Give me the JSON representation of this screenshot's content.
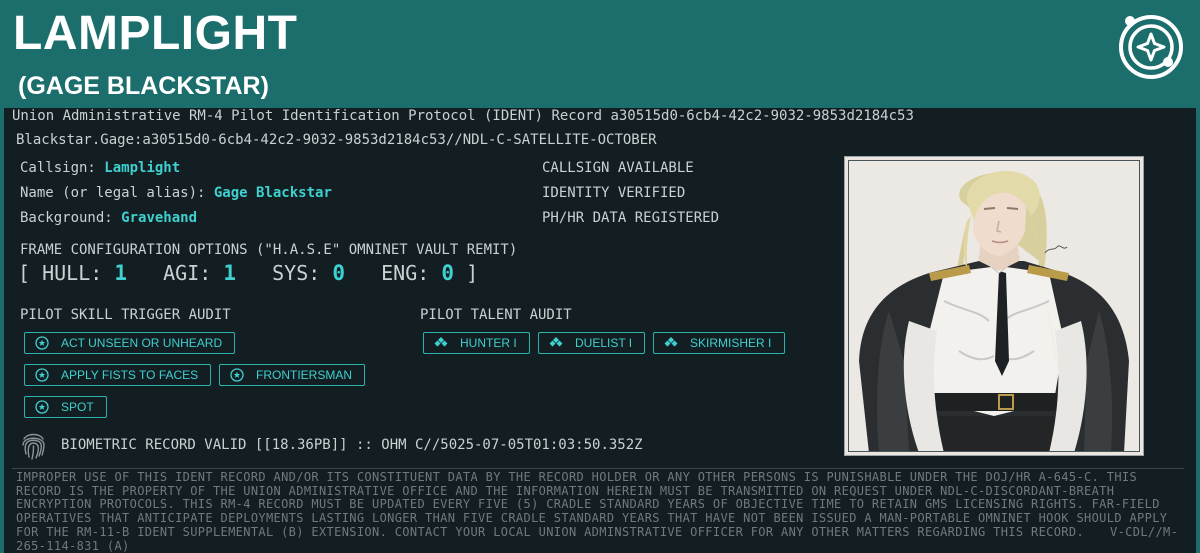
{
  "header": {
    "callsign_title": "LAMPLIGHT",
    "name_subtitle": "(GAGE BLACKSTAR)",
    "logo_icon": "compass-star-icon"
  },
  "record": {
    "ident_line": "Union Administrative RM-4 Pilot Identification Protocol (IDENT) Record a30515d0-6cb4-42c2-9032-9853d2184c53",
    "path_line": "Blackstar.Gage:a30515d0-6cb4-42c2-9032-9853d2184c53//NDL-C-SATELLITE-OCTOBER"
  },
  "fields": {
    "callsign_label": "Callsign:",
    "callsign_value": "Lamplight",
    "name_label": "Name (or legal alias):",
    "name_value": "Gage Blackstar",
    "background_label": "Background:",
    "background_value": "Gravehand"
  },
  "status": {
    "callsign": "CALLSIGN AVAILABLE",
    "identity": "IDENTITY VERIFIED",
    "phhr": "PH/HR DATA REGISTERED"
  },
  "frame": {
    "heading": "FRAME CONFIGURATION OPTIONS (\"H.A.S.E\" OMNINET VAULT REMIT)",
    "open_bracket": "[",
    "hull_label": "HULL:",
    "hull_value": "1",
    "agi_label": "AGI:",
    "agi_value": "1",
    "sys_label": "SYS:",
    "sys_value": "0",
    "eng_label": "ENG:",
    "eng_value": "0",
    "close_bracket": "]"
  },
  "skills": {
    "heading": "PILOT SKILL TRIGGER AUDIT",
    "items": [
      "ACT UNSEEN OR UNHEARD",
      "APPLY FISTS TO FACES",
      "FRONTIERSMAN",
      "SPOT"
    ],
    "icon": "star-circle-icon"
  },
  "talents": {
    "heading": "PILOT TALENT AUDIT",
    "items": [
      "HUNTER I",
      "DUELIST I",
      "SKIRMISHER I"
    ],
    "icon": "diamond-cluster-icon"
  },
  "biometric": {
    "icon": "fingerprint-icon",
    "text": "BIOMETRIC RECORD VALID [[18.36PB]] :: OHM C//5025-07-05T01:03:50.352Z"
  },
  "legal": {
    "text": "IMPROPER USE OF THIS IDENT RECORD AND/OR ITS CONSTITUENT DATA BY THE RECORD HOLDER OR ANY OTHER PERSONS IS PUNISHABLE UNDER THE DOJ/HR A-645-C. THIS RECORD IS THE PROPERTY OF THE UNION ADMINISTRATIVE OFFICE AND THE INFORMATION HEREIN MUST BE TRANSMITTED ON REQUEST UNDER NDL-C-DISCORDANT-BREATH ENCRYPTION PROTOCOLS. THIS RM-4 RECORD MUST BE UPDATED EVERY FIVE (5) CRADLE STANDARD YEARS OF OBJECTIVE TIME TO RETAIN GMS LICENSING RIGHTS. FAR-FIELD OPERATIVES THAT ANTICIPATE DEPLOYMENTS LASTING LONGER THAN FIVE CRADLE STANDARD YEARS THAT HAVE NOT BEEN ISSUED A MAN-PORTABLE OMNINET HOOK SHOULD APPLY FOR THE RM-11-B IDENT SUPPLEMENTAL (B) EXTENSION. CONTACT YOUR LOCAL UNION ADMINSTRATIVE OFFICER FOR ANY OTHER MATTERS REGARDING THIS RECORD.",
    "form_code": "V-CDL//M-265-114-831 (A)"
  },
  "portrait": {
    "subject": "pilot-portrait"
  },
  "colors": {
    "header_bg": "#1b6e6c",
    "panel_bg": "#121e22",
    "accent": "#3fd0cf",
    "text": "#c9d1d3",
    "legal_text": "#6f7a7d"
  }
}
